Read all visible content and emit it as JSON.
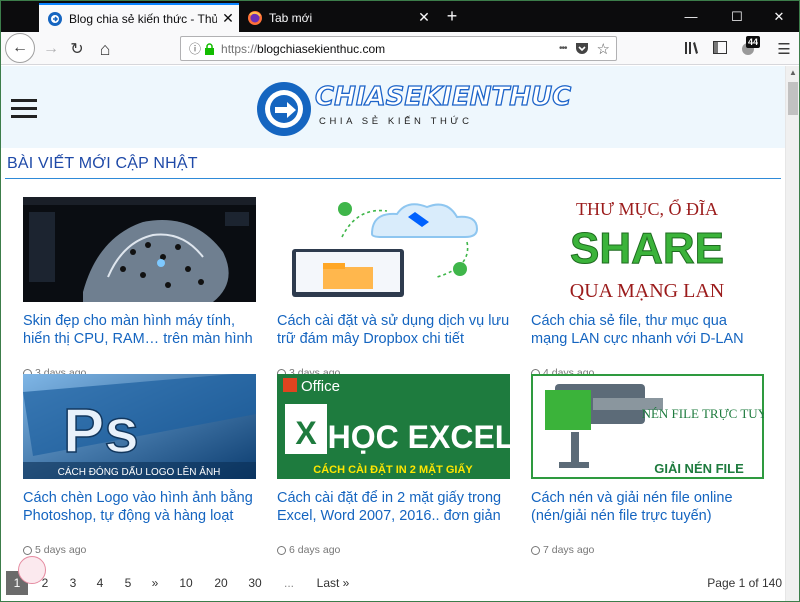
{
  "browser": {
    "tabs": [
      {
        "title": "Blog chia sẻ kiến thức - Thủ thuật",
        "close": "✕",
        "favicon": "site-logo-icon"
      },
      {
        "title": "Tab mới",
        "close": "✕",
        "favicon": "firefox-icon"
      }
    ],
    "new_tab": "+",
    "window_controls": {
      "minimize": "—",
      "maximize": "☐",
      "close": "✕"
    },
    "nav": {
      "back": "←",
      "forward": "→",
      "reload": "↻",
      "home": "⌂"
    },
    "url": {
      "protocol": "https://",
      "host": "blogchiasekienthuc.com"
    },
    "url_icons": {
      "info": "ⓘ",
      "lock": "🔒",
      "more": "•••",
      "pocket": "pocket-icon",
      "bookmark": "☆"
    },
    "toolbar_icons": {
      "library": "library-icon",
      "sidebar": "sidebar-icon",
      "addon_badge": "44",
      "menu": "☰"
    }
  },
  "site": {
    "logo_text": "CHIASEKIENTHUC",
    "logo_tagline": "CHIA SẺ KIẾN THỨC",
    "section_title": "BÀI VIẾT MỚI CẬP NHẬT",
    "accent_color": "#1565c0"
  },
  "posts": [
    {
      "title": "Skin đẹp cho màn hình máy tính, hiển thị CPU, RAM… trên màn hình",
      "date": "3 days ago",
      "thumb": "leopard-desktop-skin"
    },
    {
      "title": "Cách cài đặt và sử dụng dịch vụ lưu trữ đám mây Dropbox chi tiết",
      "date": "3 days ago",
      "thumb": "dropbox-cloud-sync"
    },
    {
      "title": "Cách chia sẻ file, thư mục qua mạng LAN cực nhanh với D-LAN",
      "date": "4 days ago",
      "thumb": "share-lan",
      "thumb_top": "THƯ MỤC, Ổ ĐĨA",
      "thumb_mid": "SHARE",
      "thumb_bottom": "QUA MẠNG LAN"
    },
    {
      "title": "Cách chèn Logo vào hình ảnh bằng Photoshop, tự động và hàng loạt",
      "date": "5 days ago",
      "thumb": "photoshop-logo",
      "thumb_mid": "Ps",
      "thumb_bottom": "CÁCH ĐÓNG DẤU LOGO LÊN ẢNH"
    },
    {
      "title": "Cách cài đặt để in 2 mặt giấy trong Excel, Word 2007, 2016.. đơn giản",
      "date": "6 days ago",
      "thumb": "excel-print",
      "thumb_top": "Office",
      "thumb_mid": "HỌC EXCEL",
      "thumb_bottom": "CÁCH CÀI ĐẶT IN 2 MẶT GIẤY"
    },
    {
      "title": "Cách nén và giải nén file online (nén/giải nén file trực tuyến)",
      "date": "7 days ago",
      "thumb": "compress-file",
      "thumb_top": "NÉN FILE TRỰC TUYẾN",
      "thumb_bottom": "GIẢI NÉN FILE"
    }
  ],
  "pagination": {
    "pages": [
      "1",
      "2",
      "3",
      "4",
      "5",
      "»",
      "10",
      "20",
      "30",
      "...",
      "Last »"
    ],
    "current": "1",
    "page_of": "Page 1 of 140"
  }
}
